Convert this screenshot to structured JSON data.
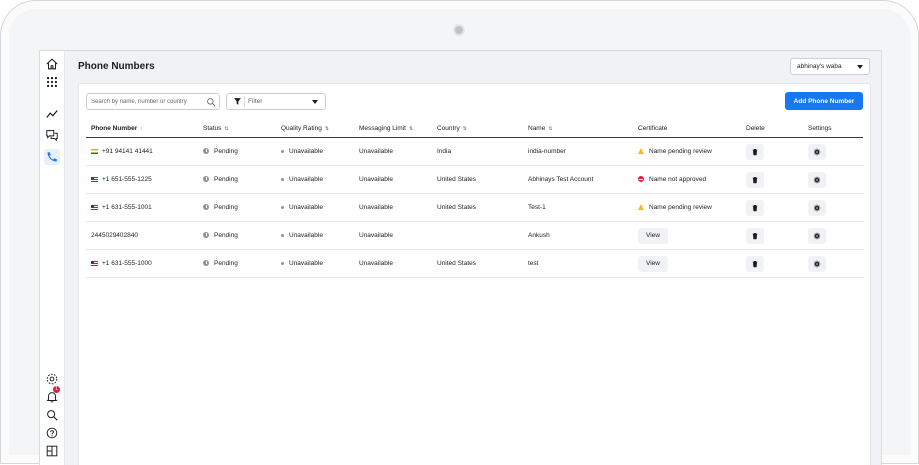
{
  "page": {
    "title": "Phone Numbers"
  },
  "account": {
    "selected": "abhinay's waba"
  },
  "toolbar": {
    "search_placeholder": "Search by name, number or country",
    "filter_label": "Filter",
    "add_button": "Add Phone Number"
  },
  "sidebar": {
    "top_icons": [
      "home-icon",
      "apps-grid-icon",
      "insights-icon",
      "chat-icon",
      "phone-icon"
    ],
    "bottom_icons": [
      "settings-icon",
      "notifications-icon",
      "search-icon",
      "help-icon",
      "panel-icon"
    ],
    "notification_count": "1"
  },
  "table": {
    "headers": {
      "phone": "Phone Number",
      "status": "Status",
      "quality": "Quality Rating",
      "limit": "Messaging Limit",
      "country": "Country",
      "name": "Name",
      "certificate": "Certificate",
      "delete": "Delete",
      "settings": "Settings"
    },
    "view_label": "View",
    "rows": [
      {
        "phone": "+91 94141 41441",
        "flag": "in",
        "status": "Pending",
        "quality": "Unavailable",
        "limit": "Unavailable",
        "country": "India",
        "name": "india-number",
        "certificate": "Name pending review",
        "cert_type": "warning"
      },
      {
        "phone": "+1 651-555-1225",
        "flag": "us",
        "status": "Pending",
        "quality": "Unavailable",
        "limit": "Unavailable",
        "country": "United States",
        "name": "Abhinays Test Account",
        "certificate": "Name not approved",
        "cert_type": "error"
      },
      {
        "phone": "+1 631-555-1001",
        "flag": "us",
        "status": "Pending",
        "quality": "Unavailable",
        "limit": "Unavailable",
        "country": "United States",
        "name": "Test-1",
        "certificate": "Name pending review",
        "cert_type": "warning"
      },
      {
        "phone": "2445029402840",
        "flag": "",
        "status": "Pending",
        "quality": "Unavailable",
        "limit": "Unavailable",
        "country": "",
        "name": "Ankush",
        "certificate": "View",
        "cert_type": "view"
      },
      {
        "phone": "+1 631-555-1000",
        "flag": "us",
        "status": "Pending",
        "quality": "Unavailable",
        "limit": "Unavailable",
        "country": "United States",
        "name": "test",
        "certificate": "View",
        "cert_type": "view"
      }
    ]
  },
  "colors": {
    "primary": "#1877f2",
    "warning": "#f7b928",
    "error": "#e41e3f",
    "muted": "#8d949e"
  }
}
